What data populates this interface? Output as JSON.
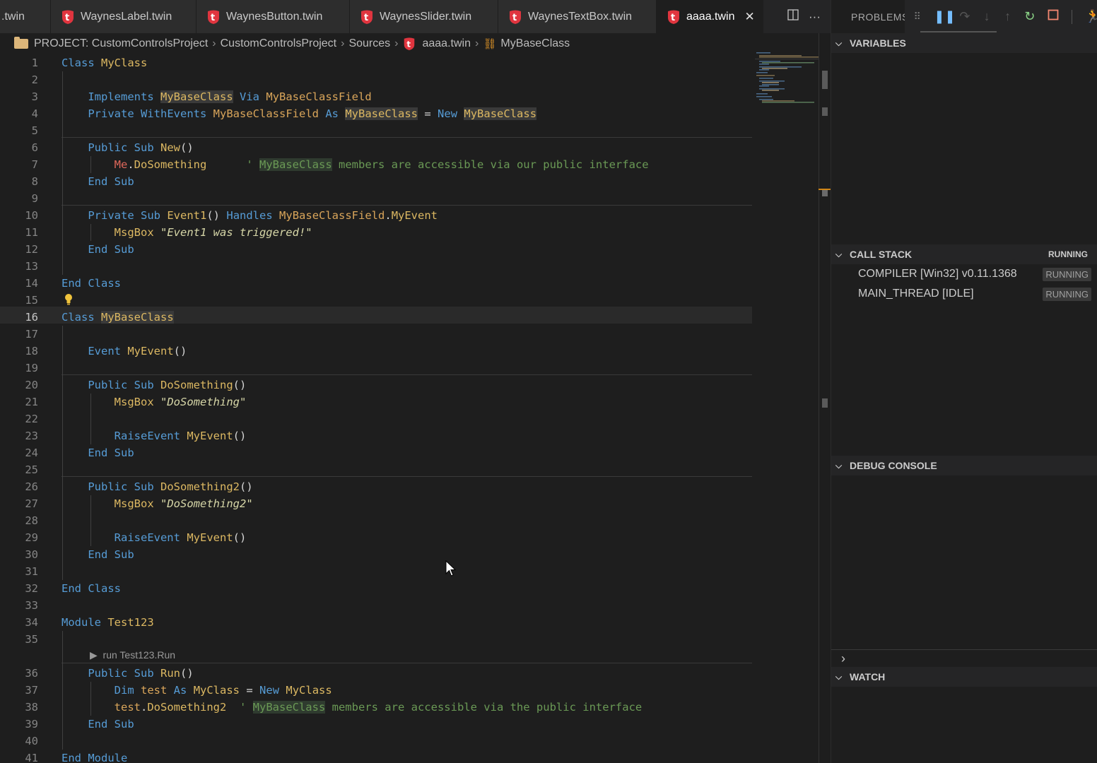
{
  "tabs": [
    {
      "label": ".twin",
      "active": false
    },
    {
      "label": "WaynesLabel.twin",
      "active": false
    },
    {
      "label": "WaynesButton.twin",
      "active": false
    },
    {
      "label": "WaynesSlider.twin",
      "active": false
    },
    {
      "label": "WaynesTextBox.twin",
      "active": false
    },
    {
      "label": "aaaa.twin",
      "active": true
    }
  ],
  "breadcrumb": {
    "project": "PROJECT: CustomControlsProject",
    "folder": "CustomControlsProject",
    "sources": "Sources",
    "file": "aaaa.twin",
    "symbol": "MyBaseClass"
  },
  "editor": {
    "current_line": 16,
    "codelens": "run Test123.Run"
  },
  "right_panel": {
    "problems_label": "PROBLEMS",
    "variables_label": "VARIABLES",
    "call_stack_label": "CALL STACK",
    "call_stack_status": "RUNNING",
    "call_stack": [
      {
        "name": "COMPILER [Win32] v0.11.1368",
        "status": "RUNNING"
      },
      {
        "name": "MAIN_THREAD [IDLE]",
        "status": "RUNNING"
      }
    ],
    "debug_console_label": "DEBUG CONSOLE",
    "watch_label": "WATCH"
  },
  "colors": {
    "keyword": "#569cd6",
    "type": "#dcb862",
    "comment": "#6a9955",
    "string": "#d7d7a8",
    "accent_me": "#e0685b",
    "twin_icon": "#e0353f"
  }
}
